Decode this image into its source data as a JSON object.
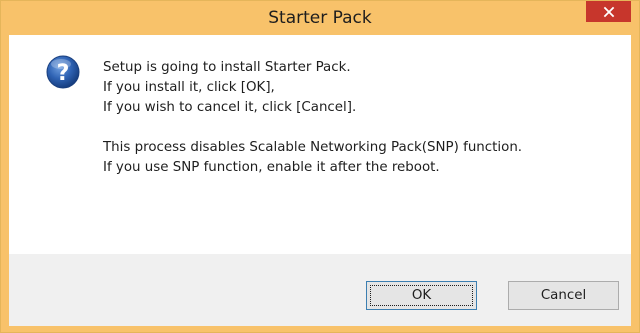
{
  "dialog": {
    "title": "Starter Pack",
    "close_icon": "close-icon",
    "icon": "question-icon",
    "message_lines": [
      "Setup is going to install Starter Pack.",
      "If you install it, click [OK],",
      "If you wish to cancel it, click [Cancel]."
    ],
    "note_lines": [
      "This process disables Scalable Networking Pack(SNP) function.",
      "If you use SNP function, enable it after the reboot."
    ],
    "buttons": {
      "ok_label": "OK",
      "cancel_label": "Cancel"
    }
  },
  "colors": {
    "frame": "#f8c26a",
    "close_button": "#c7362c",
    "icon_blue": "#2a5fa8",
    "footer": "#f0f0f0"
  }
}
